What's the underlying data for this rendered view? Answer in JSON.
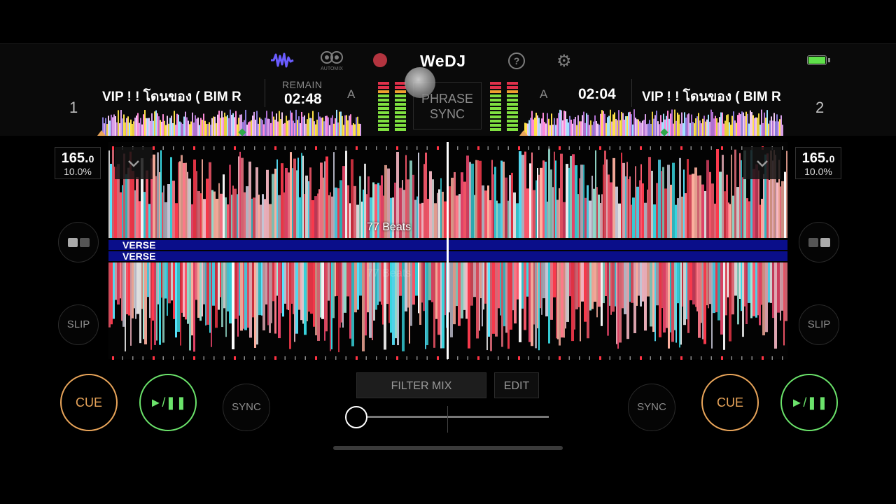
{
  "app": {
    "name": "WeDJ"
  },
  "topbar": {
    "automix_label": "AUTOMIX"
  },
  "deck1": {
    "number": "1",
    "title": "VIP ! ! โดนของ ( BIM R",
    "remain_label": "REMAIN",
    "time": "02:48",
    "key": "A",
    "bpm_int": "165.",
    "bpm_dec": "0",
    "pitch": "10.0%",
    "slip_label": "SLIP",
    "sync_label": "SYNC",
    "cue_label": "CUE",
    "play_label": "►/❚❚",
    "beats_label": "77 Beats",
    "phrase_label": "VERSE"
  },
  "deck2": {
    "number": "2",
    "title": "VIP ! ! โดนของ ( BIM R",
    "time": "02:04",
    "key": "A",
    "bpm_int": "165.",
    "bpm_dec": "0",
    "pitch": "10.0%",
    "slip_label": "SLIP",
    "sync_label": "SYNC",
    "cue_label": "CUE",
    "play_label": "►/❚❚",
    "beats_label": "77 Beats",
    "phrase_label": "VERSE"
  },
  "center": {
    "phrase_sync_line1": "PHRASE",
    "phrase_sync_line2": "SYNC",
    "filter_mix_label": "FILTER MIX",
    "edit_label": "EDIT",
    "crossfader_value": 0.03
  },
  "colors": {
    "accent_purple": "#6a5cff",
    "rec_red": "#b3343f",
    "cue_orange": "#e9a55a",
    "play_green": "#6be36b",
    "battery_green": "#5fe04a",
    "phrase_blue": "#0a0e8a"
  },
  "icons": [
    "waveform-icon",
    "automix-icon",
    "record-icon",
    "help-icon",
    "gear-icon",
    "battery-icon",
    "chevron-down-icon",
    "deck-layout-icon"
  ]
}
